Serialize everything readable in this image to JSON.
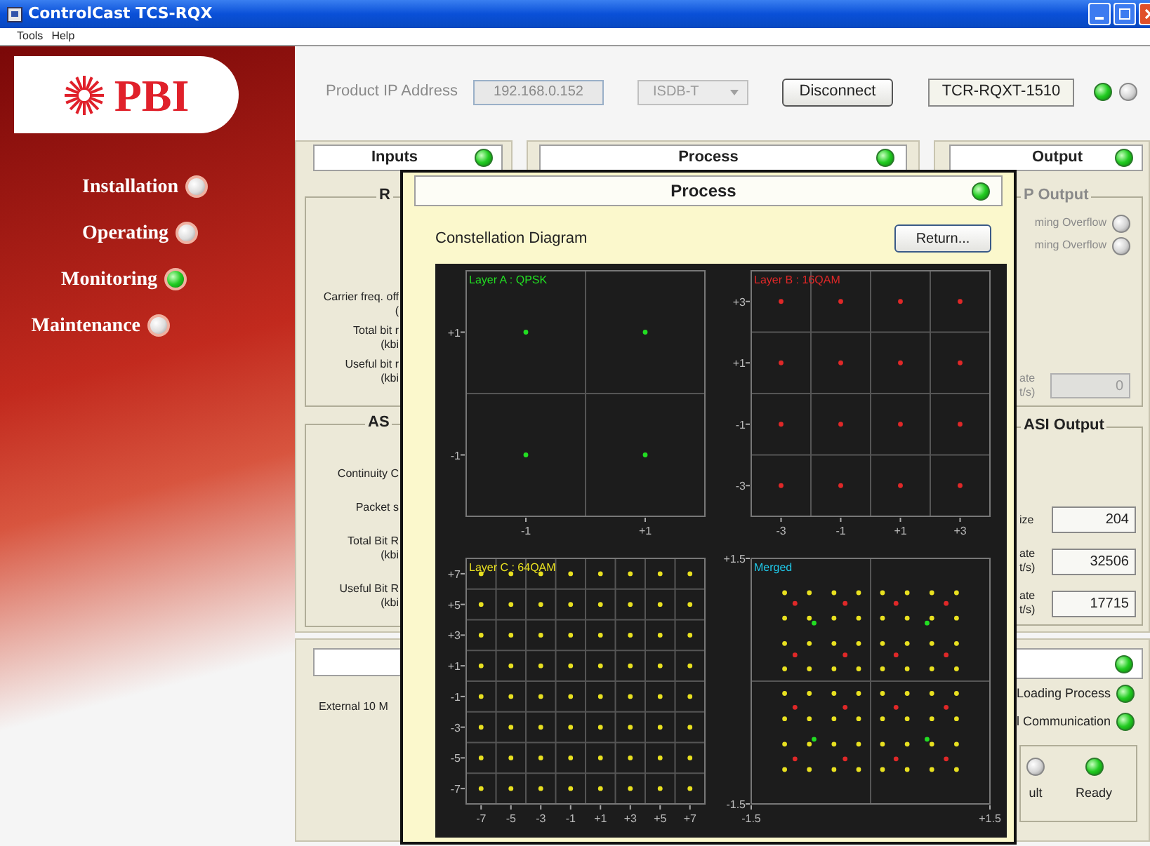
{
  "window": {
    "title": "ControlCast TCS-RQX"
  },
  "menu": [
    "Tools",
    "Help"
  ],
  "logo": {
    "text": "PBI"
  },
  "nav": [
    {
      "label": "Installation",
      "selected": false
    },
    {
      "label": "Operating",
      "selected": false
    },
    {
      "label": "Monitoring",
      "selected": true
    },
    {
      "label": "Maintenance",
      "selected": false
    }
  ],
  "connection": {
    "ip_label": "Product IP Address",
    "ip_value": "192.168.0.152",
    "standard": "ISDB-T",
    "disconnect_button": "Disconnect",
    "device": "TCR-RQXT-1510",
    "leds": [
      {
        "on": true
      },
      {
        "on": false
      }
    ]
  },
  "inputs": {
    "title": "Inputs",
    "led_on": true,
    "rf_group": "R",
    "rf_rows": [
      [
        "Carrier freq. off",
        "("
      ],
      [
        "Total bit r",
        "(kbi"
      ],
      [
        "Useful bit r",
        "(kbi"
      ]
    ],
    "asi_group": "AS",
    "asi_rows": [
      [
        "Continuity C"
      ],
      [
        "Packet s"
      ],
      [
        "Total Bit R",
        "(kbi"
      ],
      [
        "Useful Bit R",
        "(kbi"
      ]
    ],
    "bottom_row": "External 10 M"
  },
  "process": {
    "title": "Process",
    "led_on": true
  },
  "output": {
    "title": "Output",
    "led_on": true,
    "ip_group": "P Output",
    "ip_rows": [
      {
        "label": "ming Overflow",
        "on": false
      },
      {
        "label": "ming Overflow",
        "on": false
      }
    ],
    "ip_rate": {
      "lines": [
        "ate",
        "t/s)"
      ],
      "value": "0",
      "disabled": true
    },
    "asi_group": "ASI Output",
    "asi_rows": [
      {
        "lines": [
          "ize"
        ],
        "value": "204"
      },
      {
        "lines": [
          "ate",
          "t/s)"
        ],
        "value": "32506"
      },
      {
        "lines": [
          "ate",
          "t/s)"
        ],
        "value": "17715"
      }
    ],
    "status_led_on": true,
    "status_rows": [
      {
        "label": "Loading Process",
        "on": true
      },
      {
        "label": "l Communication",
        "on": true
      }
    ],
    "state_leds": [
      {
        "label": "ult",
        "on": false
      },
      {
        "label": "Ready",
        "on": true
      }
    ]
  },
  "dialog": {
    "title": "Process",
    "led_on": true,
    "subtitle": "Constellation Diagram",
    "return_button": "Return...",
    "charts": [
      {
        "chart_data": {
          "type": "scatter",
          "title": "Layer A : QPSK",
          "xlim": [
            -2,
            2
          ],
          "ylim": [
            -2,
            2
          ],
          "xticks": [
            -1,
            {
              "value": 1,
              "label": "+1"
            }
          ],
          "yticks": [
            {
              "value": 1,
              "label": "+1"
            },
            -1
          ],
          "series": [
            {
              "color": "#22dd22",
              "x": [
                -1,
                1,
                -1,
                1
              ],
              "values": [
                1,
                1,
                -1,
                -1
              ]
            }
          ]
        }
      },
      {
        "chart_data": {
          "type": "scatter",
          "title": "Layer B : 16QAM",
          "xlim": [
            -4,
            4
          ],
          "ylim": [
            -4,
            4
          ],
          "xticks": [
            -3,
            -1,
            {
              "value": 1,
              "label": "+1"
            },
            {
              "value": 3,
              "label": "+3"
            }
          ],
          "yticks": [
            {
              "value": 3,
              "label": "+3"
            },
            {
              "value": 1,
              "label": "+1"
            },
            -1,
            -3
          ],
          "series": [
            {
              "color": "#e02828",
              "x": [
                -3,
                -1,
                1,
                3,
                -3,
                -1,
                1,
                3,
                -3,
                -1,
                1,
                3,
                -3,
                -1,
                1,
                3
              ],
              "values": [
                3,
                3,
                3,
                3,
                1,
                1,
                1,
                1,
                -1,
                -1,
                -1,
                -1,
                -3,
                -3,
                -3,
                -3
              ]
            }
          ]
        }
      },
      {
        "chart_data": {
          "type": "scatter",
          "title": "Layer C : 64QAM",
          "xlim": [
            -8,
            8
          ],
          "ylim": [
            -8,
            8
          ],
          "xticks": [
            -7,
            -5,
            -3,
            -1,
            {
              "value": 1,
              "label": "+1"
            },
            {
              "value": 3,
              "label": "+3"
            },
            {
              "value": 5,
              "label": "+5"
            },
            {
              "value": 7,
              "label": "+7"
            }
          ],
          "yticks": [
            {
              "value": 7,
              "label": "+7"
            },
            {
              "value": 5,
              "label": "+5"
            },
            {
              "value": 3,
              "label": "+3"
            },
            {
              "value": 1,
              "label": "+1"
            },
            -1,
            -3,
            -5,
            -7
          ],
          "series": [
            {
              "color": "#e8e020",
              "x": [
                -7,
                -5,
                -3,
                -1,
                1,
                3,
                5,
                7,
                -7,
                -5,
                -3,
                -1,
                1,
                3,
                5,
                7,
                -7,
                -5,
                -3,
                -1,
                1,
                3,
                5,
                7,
                -7,
                -5,
                -3,
                -1,
                1,
                3,
                5,
                7,
                -7,
                -5,
                -3,
                -1,
                1,
                3,
                5,
                7,
                -7,
                -5,
                -3,
                -1,
                1,
                3,
                5,
                7,
                -7,
                -5,
                -3,
                -1,
                1,
                3,
                5,
                7,
                -7,
                -5,
                -3,
                -1,
                1,
                3,
                5,
                7
              ],
              "values": [
                7,
                7,
                7,
                7,
                7,
                7,
                7,
                7,
                5,
                5,
                5,
                5,
                5,
                5,
                5,
                5,
                3,
                3,
                3,
                3,
                3,
                3,
                3,
                3,
                1,
                1,
                1,
                1,
                1,
                1,
                1,
                1,
                -1,
                -1,
                -1,
                -1,
                -1,
                -1,
                -1,
                -1,
                -3,
                -3,
                -3,
                -3,
                -3,
                -3,
                -3,
                -3,
                -5,
                -5,
                -5,
                -5,
                -5,
                -5,
                -5,
                -5,
                -7,
                -7,
                -7,
                -7,
                -7,
                -7,
                -7,
                -7
              ]
            }
          ]
        }
      },
      {
        "chart_data": {
          "type": "scatter",
          "title": "Merged",
          "xlim": [
            -1.5,
            1.5
          ],
          "ylim": [
            -1.5,
            1.5
          ],
          "xticks": [
            -1.5,
            {
              "value": 1.5,
              "label": "+1.5"
            }
          ],
          "yticks": [
            {
              "value": 1.5,
              "label": "+1.5"
            },
            -1.5
          ],
          "series": [
            {
              "color": "#e8e020",
              "x": [
                -1.08,
                -0.77,
                -0.46,
                -0.15,
                0.15,
                0.46,
                0.77,
                1.08,
                -1.08,
                -0.77,
                -0.46,
                -0.15,
                0.15,
                0.46,
                0.77,
                1.08,
                -1.08,
                -0.77,
                -0.46,
                -0.15,
                0.15,
                0.46,
                0.77,
                1.08,
                -1.08,
                -0.77,
                -0.46,
                -0.15,
                0.15,
                0.46,
                0.77,
                1.08,
                -1.08,
                -0.77,
                -0.46,
                -0.15,
                0.15,
                0.46,
                0.77,
                1.08,
                -1.08,
                -0.77,
                -0.46,
                -0.15,
                0.15,
                0.46,
                0.77,
                1.08,
                -1.08,
                -0.77,
                -0.46,
                -0.15,
                0.15,
                0.46,
                0.77,
                1.08,
                -1.08,
                -0.77,
                -0.46,
                -0.15,
                0.15,
                0.46,
                0.77,
                1.08
              ],
              "values": [
                1.08,
                1.08,
                1.08,
                1.08,
                1.08,
                1.08,
                1.08,
                1.08,
                0.77,
                0.77,
                0.77,
                0.77,
                0.77,
                0.77,
                0.77,
                0.77,
                0.46,
                0.46,
                0.46,
                0.46,
                0.46,
                0.46,
                0.46,
                0.46,
                0.15,
                0.15,
                0.15,
                0.15,
                0.15,
                0.15,
                0.15,
                0.15,
                -0.15,
                -0.15,
                -0.15,
                -0.15,
                -0.15,
                -0.15,
                -0.15,
                -0.15,
                -0.46,
                -0.46,
                -0.46,
                -0.46,
                -0.46,
                -0.46,
                -0.46,
                -0.46,
                -0.77,
                -0.77,
                -0.77,
                -0.77,
                -0.77,
                -0.77,
                -0.77,
                -0.77,
                -1.08,
                -1.08,
                -1.08,
                -1.08,
                -1.08,
                -1.08,
                -1.08,
                -1.08
              ]
            },
            {
              "color": "#e02828",
              "x": [
                -0.95,
                -0.32,
                0.32,
                0.95,
                -0.95,
                -0.32,
                0.32,
                0.95,
                -0.95,
                -0.32,
                0.32,
                0.95,
                -0.95,
                -0.32,
                0.32,
                0.95
              ],
              "values": [
                0.95,
                0.95,
                0.95,
                0.95,
                0.32,
                0.32,
                0.32,
                0.32,
                -0.32,
                -0.32,
                -0.32,
                -0.32,
                -0.95,
                -0.95,
                -0.95,
                -0.95
              ]
            },
            {
              "color": "#22dd22",
              "x": [
                -0.71,
                0.71,
                -0.71,
                0.71
              ],
              "values": [
                0.71,
                0.71,
                -0.71,
                -0.71
              ]
            }
          ]
        }
      }
    ]
  }
}
